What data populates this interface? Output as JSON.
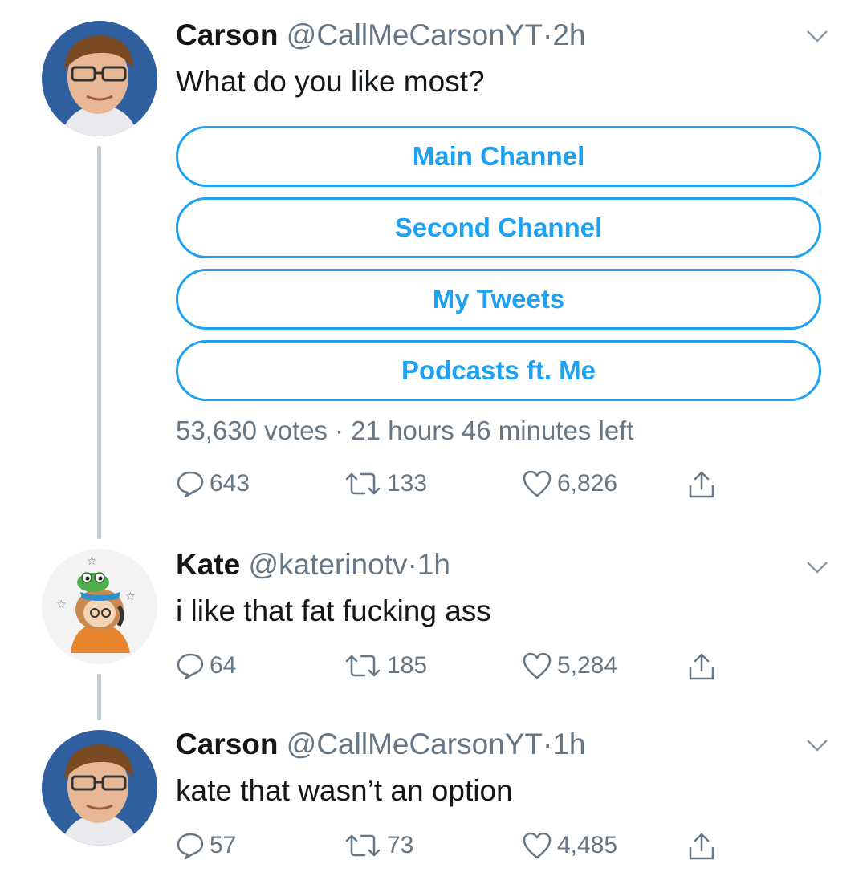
{
  "colors": {
    "accent": "#1da1f2",
    "muted": "#657786",
    "text": "#14171a",
    "thread_line": "#c4cfd6"
  },
  "icons": {
    "reply": "reply-icon",
    "retweet": "retweet-icon",
    "like": "heart-icon",
    "share": "share-icon",
    "menu": "chevron-down-icon"
  },
  "tweets": [
    {
      "name": "Carson",
      "handle": "@CallMeCarsonYT",
      "separator": "·",
      "time": "2h",
      "text": "What do you like most?",
      "poll": {
        "options": [
          "Main Channel",
          "Second Channel",
          "My Tweets",
          "Podcasts ft. Me"
        ],
        "meta": "53,630 votes · 21 hours 46 minutes left"
      },
      "replies": "643",
      "retweets": "133",
      "likes": "6,826"
    },
    {
      "name": "Kate",
      "handle": "@katerinotv",
      "separator": "·",
      "time": "1h",
      "text": "i like that fat fucking ass",
      "replies": "64",
      "retweets": "185",
      "likes": "5,284"
    },
    {
      "name": "Carson",
      "handle": "@CallMeCarsonYT",
      "separator": "·",
      "time": "1h",
      "text": "kate that wasn’t an option",
      "replies": "57",
      "retweets": "73",
      "likes": "4,485"
    }
  ]
}
